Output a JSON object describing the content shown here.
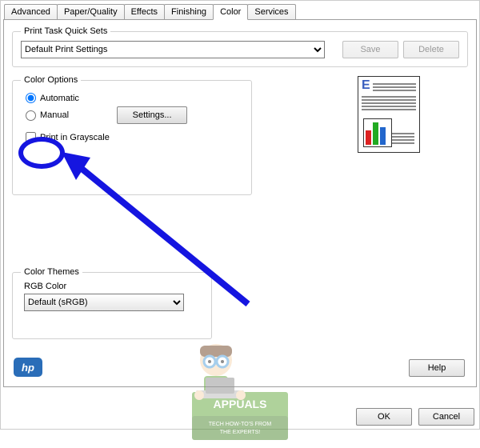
{
  "tabs": {
    "advanced": "Advanced",
    "paper_quality": "Paper/Quality",
    "effects": "Effects",
    "finishing": "Finishing",
    "color": "Color",
    "services": "Services",
    "active": "color"
  },
  "quicksets": {
    "legend": "Print Task Quick Sets",
    "selected": "Default Print Settings",
    "save_label": "Save",
    "delete_label": "Delete"
  },
  "color_options": {
    "legend": "Color Options",
    "automatic_label": "Automatic",
    "manual_label": "Manual",
    "settings_label": "Settings...",
    "grayscale_label": "Print in Grayscale",
    "selected": "automatic",
    "grayscale_checked": false
  },
  "color_themes": {
    "legend": "Color Themes",
    "rgb_label": "RGB Color",
    "selected": "Default (sRGB)"
  },
  "buttons": {
    "help": "Help",
    "ok": "OK",
    "cancel": "Cancel"
  },
  "brand": {
    "hp": "hp",
    "watermark_title": "APPUALS",
    "watermark_sub1": "TECH HOW-TO'S FROM",
    "watermark_sub2": "THE EXPERTS!"
  }
}
